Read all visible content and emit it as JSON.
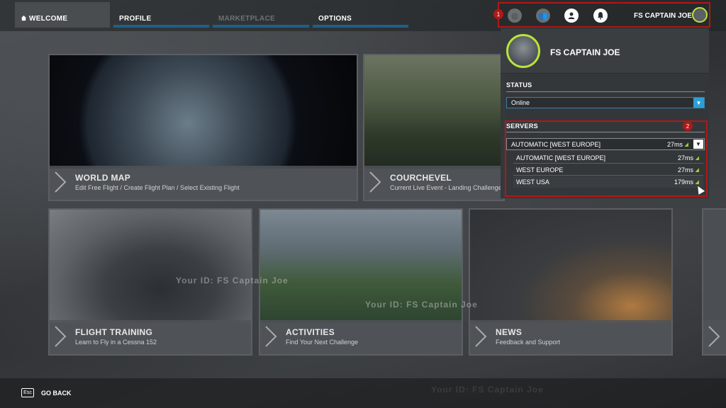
{
  "nav": {
    "tabs": [
      {
        "label": "WELCOME",
        "state": "active"
      },
      {
        "label": "PROFILE",
        "state": "normal"
      },
      {
        "label": "MARKETPLACE",
        "state": "disabled"
      },
      {
        "label": "OPTIONS",
        "state": "normal"
      }
    ]
  },
  "userbar": {
    "icons": [
      "activity-icon",
      "friends-icon",
      "profile-icon",
      "notifications-icon"
    ],
    "username": "FS CAPTAIN JOE",
    "badge1": "1",
    "badge2": "2"
  },
  "tiles": [
    {
      "title": "WORLD MAP",
      "subtitle": "Edit Free Flight / Create Flight Plan / Select Existing Flight"
    },
    {
      "title": "COURCHEVEL",
      "subtitle": "Current Live Event - Landing Challenge"
    },
    {
      "title": "FLIGHT TRAINING",
      "subtitle": "Learn to Fly in a Cessna 152"
    },
    {
      "title": "ACTIVITIES",
      "subtitle": "Find Your Next Challenge"
    },
    {
      "title": "NEWS",
      "subtitle": "Feedback and Support"
    }
  ],
  "panel": {
    "name": "FS CAPTAIN JOE",
    "status_label": "STATUS",
    "status_value": "Online",
    "servers_label": "SERVERS",
    "selected_server": {
      "name": "AUTOMATIC [WEST EUROPE]",
      "ping": "27ms"
    },
    "servers": [
      {
        "name": "AUTOMATIC [WEST EUROPE]",
        "ping": "27ms"
      },
      {
        "name": "WEST EUROPE",
        "ping": "27ms"
      },
      {
        "name": "WEST USA",
        "ping": "179ms"
      }
    ]
  },
  "footer": {
    "esc_label": "Esc",
    "go_back": "GO BACK"
  },
  "watermark": "Your ID: FS Captain Joe",
  "colors": {
    "accent_blue": "#2aa0d6",
    "highlight_red": "#b01818",
    "avatar_ring": "#b9e33b"
  }
}
